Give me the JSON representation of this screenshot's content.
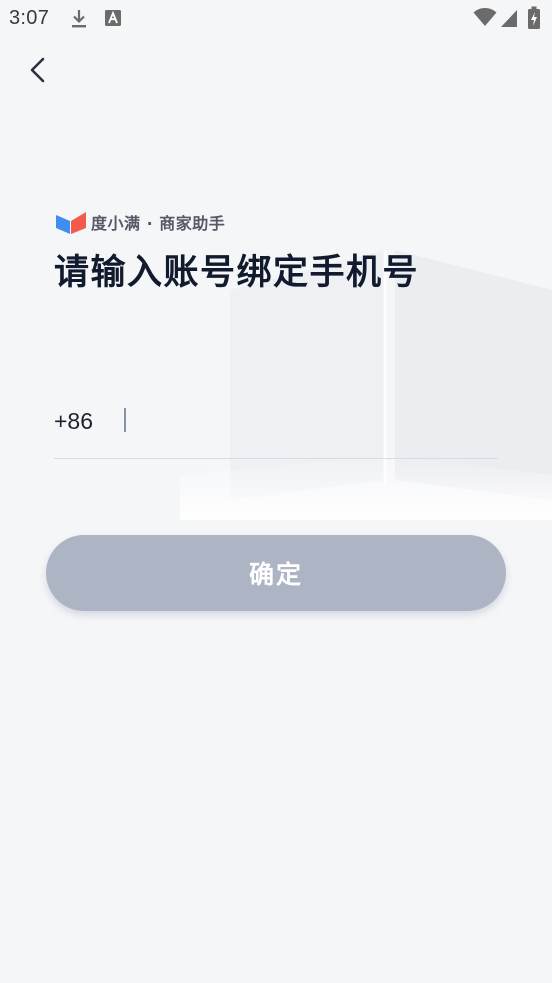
{
  "status_bar": {
    "time": "3:07",
    "left_icons": [
      "download-icon",
      "text-a-icon"
    ],
    "right_icons": [
      "wifi-icon",
      "cellular-signal-icon",
      "battery-charging-icon"
    ]
  },
  "navigation": {
    "back_icon": "chevron-left-icon"
  },
  "brand": {
    "logo_icon": "duxiaoman-logo-icon",
    "name": "度小满 · 商家助手"
  },
  "page": {
    "title": "请输入账号绑定手机号"
  },
  "phone_field": {
    "country_code": "+86",
    "value": "",
    "placeholder": ""
  },
  "confirm_button": {
    "label": "确定",
    "state": "disabled"
  },
  "colors": {
    "background": "#f5f6f8",
    "button_disabled": "#adb5c5",
    "title_text": "#121a2e",
    "logo_blue": "#3d8ef0",
    "logo_red": "#f25a4a"
  }
}
